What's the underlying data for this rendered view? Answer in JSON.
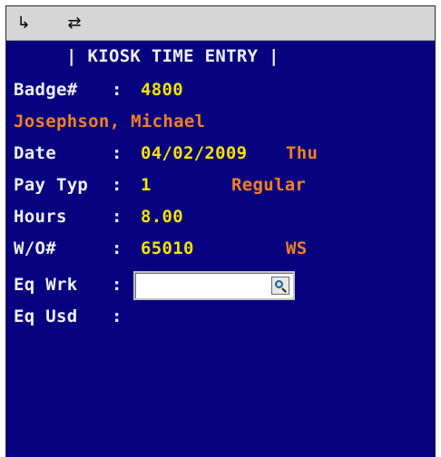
{
  "toolbar": {
    "icon_left": "↳",
    "icon_right": "⇄"
  },
  "screen": {
    "title": "| KIOSK TIME ENTRY |",
    "badge": {
      "label": "Badge#",
      "sep": ":",
      "value": "4800"
    },
    "employee_name": "Josephson, Michael",
    "date": {
      "label": "Date",
      "sep": ":",
      "value": "04/02/2009",
      "day": "Thu"
    },
    "pay_type": {
      "label": "Pay Typ",
      "sep": ":",
      "code": "1",
      "desc": "Regular"
    },
    "hours": {
      "label": "Hours",
      "sep": ":",
      "value": "8.00"
    },
    "work_order": {
      "label": "W/O#",
      "sep": ":",
      "value": "65010",
      "code": "WS"
    },
    "eq_worked": {
      "label": "Eq Wrk",
      "sep": ":",
      "value": ""
    },
    "eq_used": {
      "label": "Eq Usd",
      "sep": ":"
    }
  },
  "colors": {
    "background": "#07007f",
    "label": "#f0f0f0",
    "value": "#f2e400",
    "accent": "#f2801e",
    "toolbar": "#d6d6d6"
  }
}
